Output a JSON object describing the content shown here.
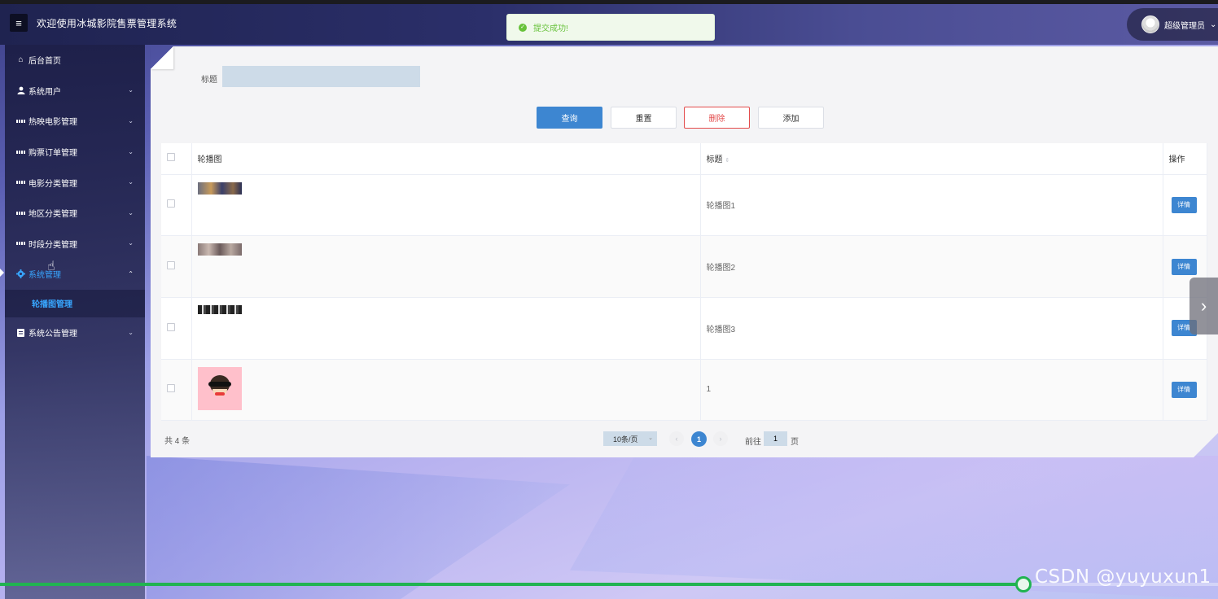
{
  "header": {
    "title": "欢迎使用冰城影院售票管理系统",
    "menu_icon": "hamburger-icon",
    "user_name": "超级管理员",
    "user_chevron": "⌄"
  },
  "toast": {
    "message": "提交成功!",
    "color": "#67c23a"
  },
  "sidebar": {
    "items": [
      {
        "label": "后台首页",
        "icon": "home-icon"
      },
      {
        "label": "系统用户",
        "icon": "user-icon",
        "chevron": "⌄"
      },
      {
        "label": "热映电影管理",
        "icon": "grid-icon",
        "chevron": "⌄"
      },
      {
        "label": "购票订单管理",
        "icon": "grid-icon",
        "chevron": "⌄"
      },
      {
        "label": "电影分类管理",
        "icon": "grid-icon",
        "chevron": "⌄"
      },
      {
        "label": "地区分类管理",
        "icon": "grid-icon",
        "chevron": "⌄"
      },
      {
        "label": "时段分类管理",
        "icon": "grid-icon",
        "chevron": "⌄"
      },
      {
        "label": "系统管理",
        "icon": "gear-icon",
        "chevron": "⌃",
        "active": true
      },
      {
        "label": "系统公告管理",
        "icon": "document-icon",
        "chevron": "⌄"
      }
    ],
    "sub_item": "轮播图管理",
    "active_color": "#38a6ff"
  },
  "search": {
    "label": "标题",
    "value": ""
  },
  "toolbar": {
    "query": "查询",
    "reset": "重置",
    "delete": "删除",
    "add": "添加"
  },
  "table": {
    "columns": [
      "轮播图",
      "标题",
      "操作"
    ],
    "rows": [
      {
        "title": "轮播图1",
        "action": "详情"
      },
      {
        "title": "轮播图2",
        "action": "详情"
      },
      {
        "title": "轮播图3",
        "action": "详情"
      },
      {
        "title": "1",
        "action": "详情"
      }
    ]
  },
  "pagination": {
    "total": "共 4 条",
    "page_size": "10条/页",
    "current_page": "1",
    "goto_prefix": "前往",
    "goto_value": "1",
    "goto_suffix": "页"
  },
  "player": {
    "progress_fraction": 0.84,
    "accent": "#21b351"
  },
  "watermark": "CSDN @yuyuxun1"
}
